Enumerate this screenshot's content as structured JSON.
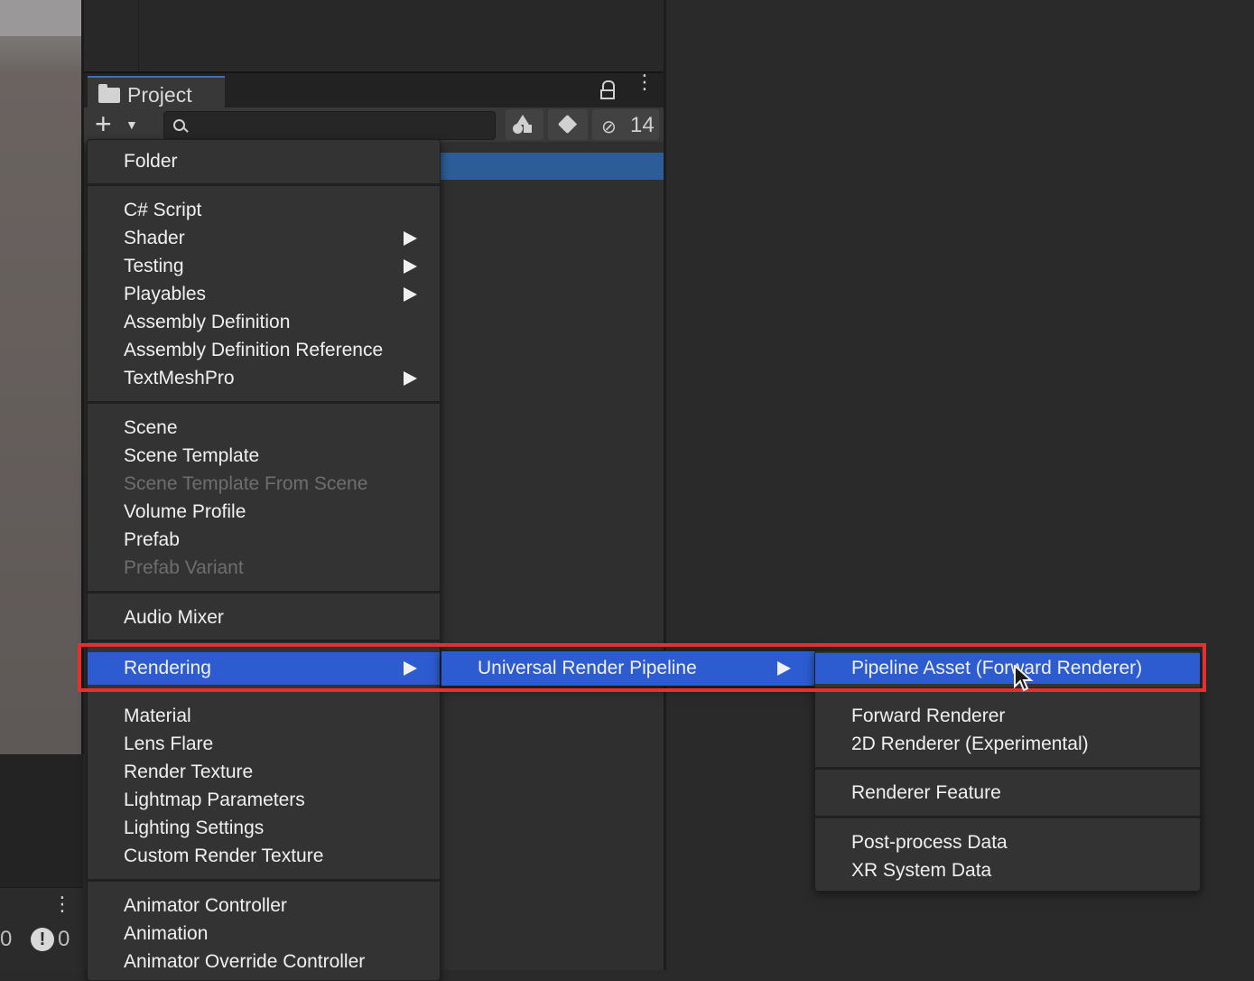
{
  "project_window": {
    "tab_label": "Project",
    "hidden_count": "14",
    "search_placeholder": ""
  },
  "console_strip": {
    "count_a": "0",
    "count_b": "0"
  },
  "main_menu": {
    "items": {
      "folder": "Folder",
      "cs_script": "C# Script",
      "shader": "Shader",
      "testing": "Testing",
      "playables": "Playables",
      "assembly_definition": "Assembly Definition",
      "assembly_definition_reference": "Assembly Definition Reference",
      "textmeshpro": "TextMeshPro",
      "scene": "Scene",
      "scene_template": "Scene Template",
      "scene_template_from_scene": "Scene Template From Scene",
      "volume_profile": "Volume Profile",
      "prefab": "Prefab",
      "prefab_variant": "Prefab Variant",
      "audio_mixer": "Audio Mixer",
      "rendering": "Rendering",
      "material": "Material",
      "lens_flare": "Lens Flare",
      "render_texture": "Render Texture",
      "lightmap_parameters": "Lightmap Parameters",
      "lighting_settings": "Lighting Settings",
      "custom_render_texture": "Custom Render Texture",
      "animator_controller": "Animator Controller",
      "animation": "Animation",
      "animator_override_controller": "Animator Override Controller"
    }
  },
  "rendering_submenu": {
    "universal_render_pipeline": "Universal Render Pipeline"
  },
  "urp_submenu": {
    "pipeline_asset": "Pipeline Asset (Forward Renderer)",
    "forward_renderer": "Forward Renderer",
    "renderer_2d": "2D Renderer (Experimental)",
    "renderer_feature": "Renderer Feature",
    "post_process_data": "Post-process Data",
    "xr_system_data": "XR System Data"
  },
  "colors": {
    "menu_highlight": "#2d5cd0",
    "annotation_outline": "#e5302f",
    "selection": "#2c5d98"
  }
}
